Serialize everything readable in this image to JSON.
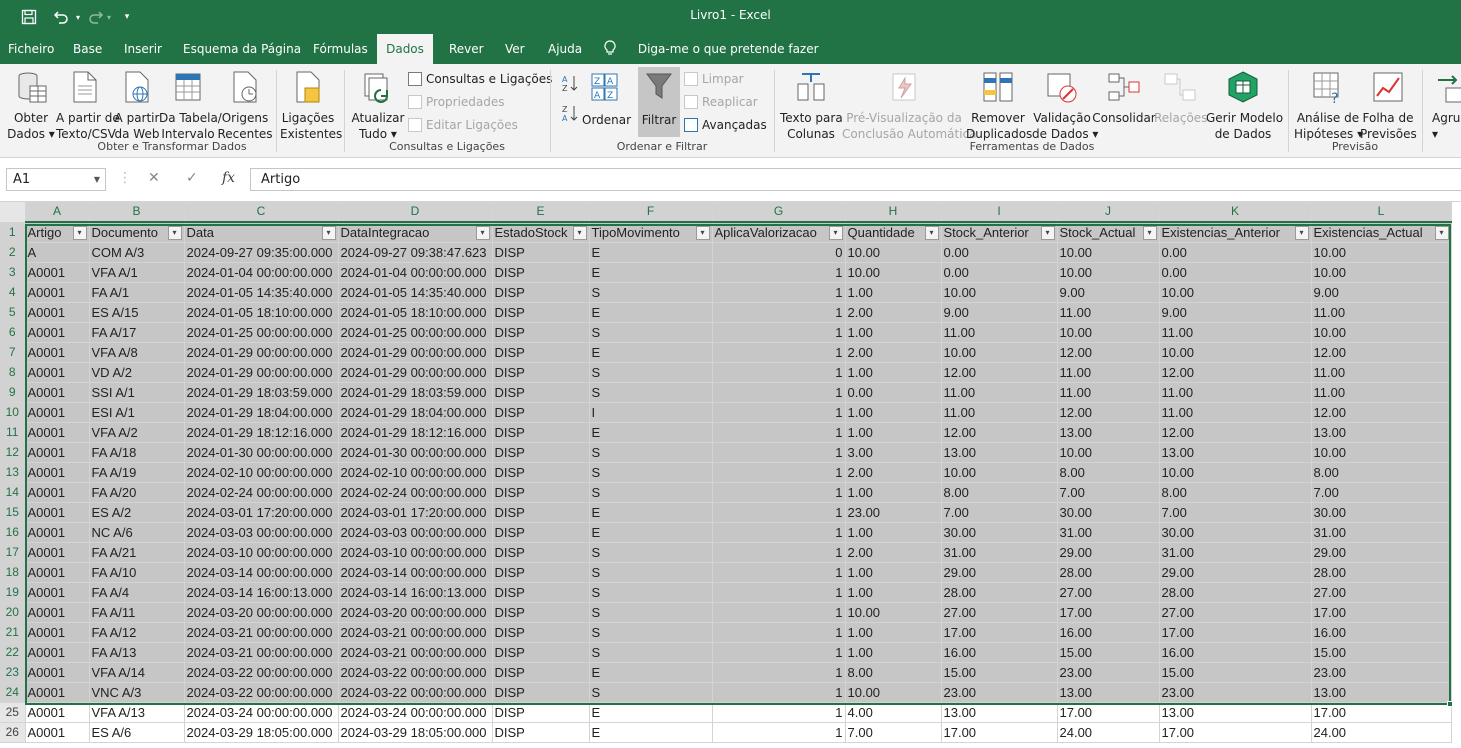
{
  "window": {
    "title": "Livro1  -  Excel"
  },
  "quick_access": {
    "customize_glyph": "▾"
  },
  "menu": {
    "tabs": [
      "Ficheiro",
      "Base",
      "Inserir",
      "Esquema da Página",
      "Fórmulas",
      "Dados",
      "Rever",
      "Ver",
      "Ajuda"
    ],
    "active": "Dados",
    "tell_me": "Diga-me o que pretende fazer"
  },
  "ribbon": {
    "group1": {
      "label": "Obter e Transformar Dados",
      "obter": "Obter\nDados ▾",
      "csv": "A partir de\nTexto/CSV",
      "web": "A partir\nda Web",
      "tabela": "Da Tabela/\nIntervalo",
      "origens": "Origens\nRecentes",
      "ligacoes": "Ligações\nExistentes"
    },
    "group2": {
      "label": "Consultas e Ligações",
      "atualizar": "Atualizar\nTudo ▾",
      "consultas": "Consultas e Ligações",
      "propriedades": "Propriedades",
      "editar": "Editar Ligações"
    },
    "group3": {
      "label": "Ordenar e Filtrar",
      "ordenar": "Ordenar",
      "filtrar": "Filtrar",
      "limpar": "Limpar",
      "reaplicar": "Reaplicar",
      "avancadas": "Avançadas"
    },
    "group4": {
      "label": "Ferramentas de Dados",
      "texto": "Texto para\nColunas",
      "previsualizacao": "Pré-Visualização da\nConclusão Automática",
      "remover": "Remover\nDuplicados",
      "validacao": "Validação\nde Dados ▾",
      "consolidar": "Consolidar",
      "relacoes": "Relações",
      "gerir": "Gerir Modelo\nde Dados"
    },
    "group5": {
      "label": "Previsão",
      "analise": "Análise de\nHipóteses ▾",
      "folha": "Folha de\nPrevisões"
    },
    "group6": {
      "agrupar": "Agrup\n▾"
    }
  },
  "formula_bar": {
    "name_box": "A1",
    "formula": "Artigo",
    "fx": "fx",
    "cancel": "✕",
    "enter": "✓"
  },
  "grid": {
    "columns": [
      "A",
      "B",
      "C",
      "D",
      "E",
      "F",
      "G",
      "H",
      "I",
      "J",
      "K",
      "L"
    ],
    "headers": [
      "Artigo",
      "Documento",
      "Data",
      "DataIntegracao",
      "EstadoStock",
      "TipoMovimento",
      "AplicaValorizacao",
      "Quantidade",
      "Stock_Anterior",
      "Stock_Actual",
      "Existencias_Anterior",
      "Existencias_Actual"
    ],
    "rows": [
      [
        "A",
        "COM A/3",
        "2024-09-27 09:35:00.000",
        "2024-09-27 09:38:47.623",
        "DISP",
        "E",
        "0",
        "10.00",
        "0.00",
        "10.00",
        "0.00",
        "10.00"
      ],
      [
        "A0001",
        "VFA A/1",
        "2024-01-04 00:00:00.000",
        "2024-01-04 00:00:00.000",
        "DISP",
        "E",
        "1",
        "10.00",
        "0.00",
        "10.00",
        "0.00",
        "10.00"
      ],
      [
        "A0001",
        "FA A/1",
        "2024-01-05 14:35:40.000",
        "2024-01-05 14:35:40.000",
        "DISP",
        "S",
        "1",
        "1.00",
        "10.00",
        "9.00",
        "10.00",
        "9.00"
      ],
      [
        "A0001",
        "ES A/15",
        "2024-01-05 18:10:00.000",
        "2024-01-05 18:10:00.000",
        "DISP",
        "E",
        "1",
        "2.00",
        "9.00",
        "11.00",
        "9.00",
        "11.00"
      ],
      [
        "A0001",
        "FA A/17",
        "2024-01-25 00:00:00.000",
        "2024-01-25 00:00:00.000",
        "DISP",
        "S",
        "1",
        "1.00",
        "11.00",
        "10.00",
        "11.00",
        "10.00"
      ],
      [
        "A0001",
        "VFA A/8",
        "2024-01-29 00:00:00.000",
        "2024-01-29 00:00:00.000",
        "DISP",
        "E",
        "1",
        "2.00",
        "10.00",
        "12.00",
        "10.00",
        "12.00"
      ],
      [
        "A0001",
        "VD A/2",
        "2024-01-29 00:00:00.000",
        "2024-01-29 00:00:00.000",
        "DISP",
        "S",
        "1",
        "1.00",
        "12.00",
        "11.00",
        "12.00",
        "11.00"
      ],
      [
        "A0001",
        "SSI A/1",
        "2024-01-29 18:03:59.000",
        "2024-01-29 18:03:59.000",
        "DISP",
        "S",
        "1",
        "0.00",
        "11.00",
        "11.00",
        "11.00",
        "11.00"
      ],
      [
        "A0001",
        "ESI A/1",
        "2024-01-29 18:04:00.000",
        "2024-01-29 18:04:00.000",
        "DISP",
        "I",
        "1",
        "1.00",
        "11.00",
        "12.00",
        "11.00",
        "12.00"
      ],
      [
        "A0001",
        "VFA A/2",
        "2024-01-29 18:12:16.000",
        "2024-01-29 18:12:16.000",
        "DISP",
        "E",
        "1",
        "1.00",
        "12.00",
        "13.00",
        "12.00",
        "13.00"
      ],
      [
        "A0001",
        "FA A/18",
        "2024-01-30 00:00:00.000",
        "2024-01-30 00:00:00.000",
        "DISP",
        "S",
        "1",
        "3.00",
        "13.00",
        "10.00",
        "13.00",
        "10.00"
      ],
      [
        "A0001",
        "FA A/19",
        "2024-02-10 00:00:00.000",
        "2024-02-10 00:00:00.000",
        "DISP",
        "S",
        "1",
        "2.00",
        "10.00",
        "8.00",
        "10.00",
        "8.00"
      ],
      [
        "A0001",
        "FA A/20",
        "2024-02-24 00:00:00.000",
        "2024-02-24 00:00:00.000",
        "DISP",
        "S",
        "1",
        "1.00",
        "8.00",
        "7.00",
        "8.00",
        "7.00"
      ],
      [
        "A0001",
        "ES A/2",
        "2024-03-01 17:20:00.000",
        "2024-03-01 17:20:00.000",
        "DISP",
        "E",
        "1",
        "23.00",
        "7.00",
        "30.00",
        "7.00",
        "30.00"
      ],
      [
        "A0001",
        "NC A/6",
        "2024-03-03 00:00:00.000",
        "2024-03-03 00:00:00.000",
        "DISP",
        "E",
        "1",
        "1.00",
        "30.00",
        "31.00",
        "30.00",
        "31.00"
      ],
      [
        "A0001",
        "FA A/21",
        "2024-03-10 00:00:00.000",
        "2024-03-10 00:00:00.000",
        "DISP",
        "S",
        "1",
        "2.00",
        "31.00",
        "29.00",
        "31.00",
        "29.00"
      ],
      [
        "A0001",
        "FA A/10",
        "2024-03-14 00:00:00.000",
        "2024-03-14 00:00:00.000",
        "DISP",
        "S",
        "1",
        "1.00",
        "29.00",
        "28.00",
        "29.00",
        "28.00"
      ],
      [
        "A0001",
        "FA A/4",
        "2024-03-14 16:00:13.000",
        "2024-03-14 16:00:13.000",
        "DISP",
        "S",
        "1",
        "1.00",
        "28.00",
        "27.00",
        "28.00",
        "27.00"
      ],
      [
        "A0001",
        "FA A/11",
        "2024-03-20 00:00:00.000",
        "2024-03-20 00:00:00.000",
        "DISP",
        "S",
        "1",
        "10.00",
        "27.00",
        "17.00",
        "27.00",
        "17.00"
      ],
      [
        "A0001",
        "FA A/12",
        "2024-03-21 00:00:00.000",
        "2024-03-21 00:00:00.000",
        "DISP",
        "S",
        "1",
        "1.00",
        "17.00",
        "16.00",
        "17.00",
        "16.00"
      ],
      [
        "A0001",
        "FA A/13",
        "2024-03-21 00:00:00.000",
        "2024-03-21 00:00:00.000",
        "DISP",
        "S",
        "1",
        "1.00",
        "16.00",
        "15.00",
        "16.00",
        "15.00"
      ],
      [
        "A0001",
        "VFA A/14",
        "2024-03-22 00:00:00.000",
        "2024-03-22 00:00:00.000",
        "DISP",
        "E",
        "1",
        "8.00",
        "15.00",
        "23.00",
        "15.00",
        "23.00"
      ],
      [
        "A0001",
        "VNC A/3",
        "2024-03-22 00:00:00.000",
        "2024-03-22 00:00:00.000",
        "DISP",
        "S",
        "1",
        "10.00",
        "23.00",
        "13.00",
        "23.00",
        "13.00"
      ],
      [
        "A0001",
        "VFA A/13",
        "2024-03-24 00:00:00.000",
        "2024-03-24 00:00:00.000",
        "DISP",
        "E",
        "1",
        "4.00",
        "13.00",
        "17.00",
        "13.00",
        "17.00"
      ],
      [
        "A0001",
        "ES A/6",
        "2024-03-29 18:05:00.000",
        "2024-03-29 18:05:00.000",
        "DISP",
        "E",
        "1",
        "7.00",
        "17.00",
        "24.00",
        "17.00",
        "24.00"
      ]
    ],
    "filter_glyph": "▾"
  },
  "colors": {
    "excel_green": "#217346",
    "selection_fill": "#c6c6c6"
  }
}
